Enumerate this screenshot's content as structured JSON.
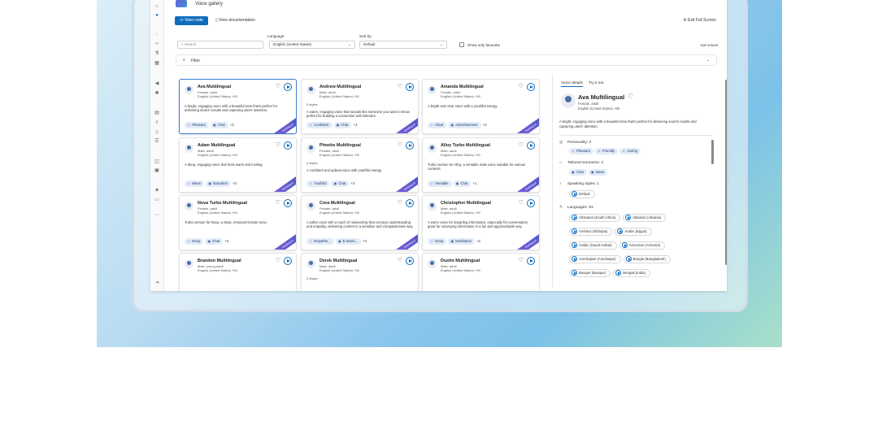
{
  "app": {
    "title": "Voice gallery"
  },
  "toolbar": {
    "view_code": "View code",
    "view_docs": "View documentation",
    "exit_full": "Exit Full Screen"
  },
  "filters": {
    "language_label": "Language",
    "language_value": "English (United States)",
    "sort_label": "Sort by",
    "sort_value": "Default",
    "search_placeholder": "Search",
    "favourites_label": "Show only favourite",
    "count": "118 voices",
    "filter_label": "Filter"
  },
  "cards": [
    {
      "name": "Ava Multilingual",
      "meta1": "Female, adult",
      "meta2": "English (United States) +90",
      "styles": "",
      "desc": "A bright, engaging voice with a beautiful tone that's perfect for delivering search results and capturing users' attention.",
      "tags": [
        "Pleasant",
        "Chat"
      ],
      "more": "+3",
      "ribbon": "Multilingual"
    },
    {
      "name": "Andrew Multilingual",
      "meta1": "Male, adult",
      "meta2": "English (United States) +90",
      "styles": "3 styles",
      "desc": "A warm, engaging voice that sounds like someone you want to know, perfect for building a connection with listeners.",
      "tags": [
        "Confident",
        "Chat"
      ],
      "more": "+3",
      "ribbon": "Multilingual"
    },
    {
      "name": "Amanda Multilingual",
      "meta1": "Female, adult",
      "meta2": "English (United States) +90",
      "styles": "",
      "desc": "A bright and clear voice with a youthful energy.",
      "tags": [
        "Clear",
        "Advertisement"
      ],
      "more": "+3",
      "ribbon": "Multilingual"
    },
    {
      "name": "Adam Multilingual",
      "meta1": "Male, adult",
      "meta2": "English (United States) +90",
      "styles": "",
      "desc": "A deep, engaging voice that feels warm and inviting.",
      "tags": [
        "Warm",
        "Narration"
      ],
      "more": "+3",
      "ribbon": "Multilingual"
    },
    {
      "name": "Phoebe Multilingual",
      "meta1": "Female, adult",
      "meta2": "English (United States) +90",
      "styles": "4 styles",
      "desc": "A confident and upbeat voice with youthful energy.",
      "tags": [
        "Youthful",
        "Chat"
      ],
      "more": "+3",
      "ribbon": "Multilingual"
    },
    {
      "name": "Alloy Turbo Multilingual",
      "meta1": "Male, adult",
      "meta2": "English (United States) +90",
      "styles": "",
      "desc": "Turbo version for Alloy, a versatile male voice suitable for various contexts.",
      "tags": [
        "Versatile",
        "Chat"
      ],
      "more": "+1",
      "ribbon": "Multilingual"
    },
    {
      "name": "Nova Turbo Multilingual",
      "meta1": "Female, adult",
      "meta2": "English (United States) +90",
      "styles": "",
      "desc": "Turbo version for Nova, a deep, resonant female voice.",
      "tags": [
        "Deep",
        "Chat"
      ],
      "more": "+2",
      "ribbon": "Multilingual"
    },
    {
      "name": "Cora Multilingual",
      "meta1": "Female, adult",
      "meta2": "English (United States) +90",
      "styles": "",
      "desc": "A softer voice with a touch of melancholy that conveys understanding and empathy, delivering content in a sensitive and compassionate way.",
      "tags": [
        "Empathe...",
        "E-learni..."
      ],
      "more": "+3",
      "ribbon": "Multilingual"
    },
    {
      "name": "Christopher Multilingual",
      "meta1": "Male, adult",
      "meta2": "English (United States) +90",
      "styles": "",
      "desc": "A warm voice for imparting information, especially for conversation, great for conveying information in a fun and approachable way.",
      "tags": [
        "Deep",
        "Meditation"
      ],
      "more": "+2",
      "ribbon": "Multilingual"
    },
    {
      "name": "Brandon Multilingual",
      "meta1": "Male, young adult",
      "meta2": "English (United States) +90",
      "styles": "",
      "desc": "",
      "tags": [],
      "more": "",
      "ribbon": ""
    },
    {
      "name": "Derek Multilingual",
      "meta1": "Male, adult",
      "meta2": "English (United States) +90",
      "styles": "3 styles",
      "desc": "",
      "tags": [],
      "more": "",
      "ribbon": ""
    },
    {
      "name": "Dustin Multilingual",
      "meta1": "Male, adult",
      "meta2": "English (United States) +90",
      "styles": "",
      "desc": "",
      "tags": [],
      "more": "",
      "ribbon": ""
    }
  ],
  "detail": {
    "tab_details": "Voice details",
    "tab_try": "Try it out",
    "name": "Ava Multilingual",
    "meta1": "Female, adult",
    "meta2": "English (United States) +90",
    "desc": "A bright, engaging voice with a beautiful tone that's perfect for delivering search results and capturing users' attention.",
    "personality_title": "Personality: 3",
    "personality": [
      "Pleasant",
      "Friendly",
      "Caring"
    ],
    "scenarios_title": "Tailored scenarios: 2",
    "scenarios": [
      "Chat",
      "News"
    ],
    "styles_title": "Speaking styles: 1",
    "styles": [
      "Default"
    ],
    "languages_title": "Languages: 91",
    "languages": [
      [
        "Afrikaans (South Africa)",
        "Albanian (Albania)"
      ],
      [
        "Amharic (Ethiopia)",
        "Arabic (Egypt)"
      ],
      [
        "Arabic (Saudi Arabia)",
        "Armenian (Armenia)"
      ],
      [
        "Azerbaijani (Azerbaijan)",
        "Bangla (Bangladesh)"
      ],
      [
        "Basque (Basque)",
        "Bengali (India)"
      ]
    ]
  },
  "colors": {
    "accent": "#0f6cbd",
    "tag_bg": "#e3ecf8",
    "ribbon": "#6b5bd6"
  }
}
